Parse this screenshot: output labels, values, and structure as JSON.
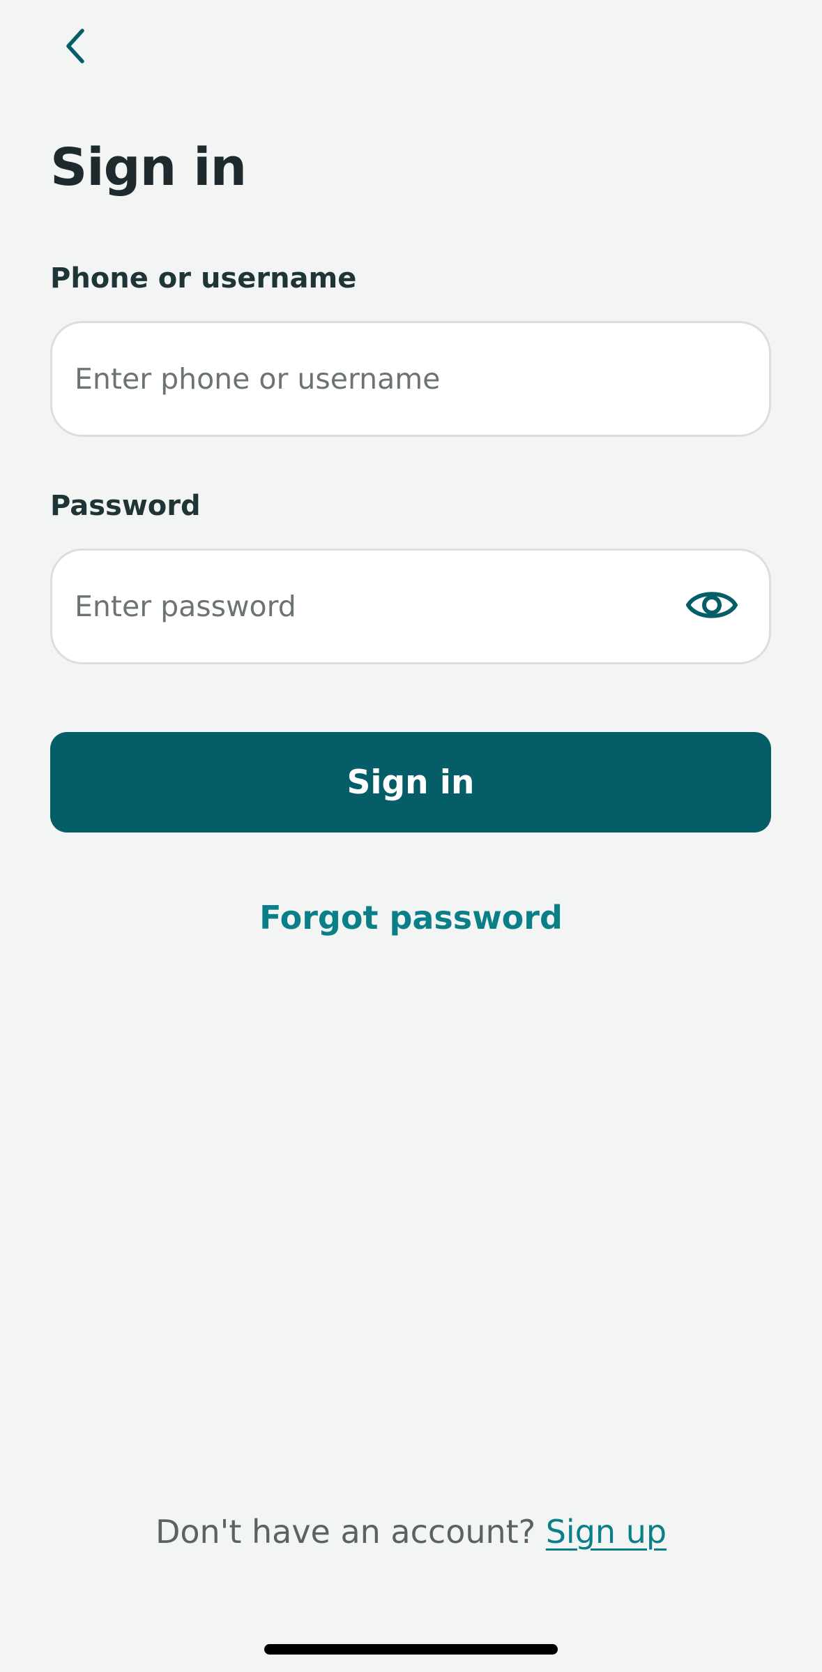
{
  "header": {
    "back_icon": "chevron-left-icon",
    "title": "Sign in"
  },
  "form": {
    "username": {
      "label": "Phone or username",
      "placeholder": "Enter phone or username",
      "value": ""
    },
    "password": {
      "label": "Password",
      "placeholder": "Enter password",
      "value": "",
      "toggle_icon": "eye-icon"
    },
    "submit_label": "Sign in",
    "forgot_label": "Forgot password"
  },
  "footer": {
    "prompt": "Don't have an account?",
    "signup_label": "Sign up"
  },
  "colors": {
    "background": "#f3f5f4",
    "primary": "#045d67",
    "link": "#0b7f88",
    "title": "#1f2a2e"
  }
}
